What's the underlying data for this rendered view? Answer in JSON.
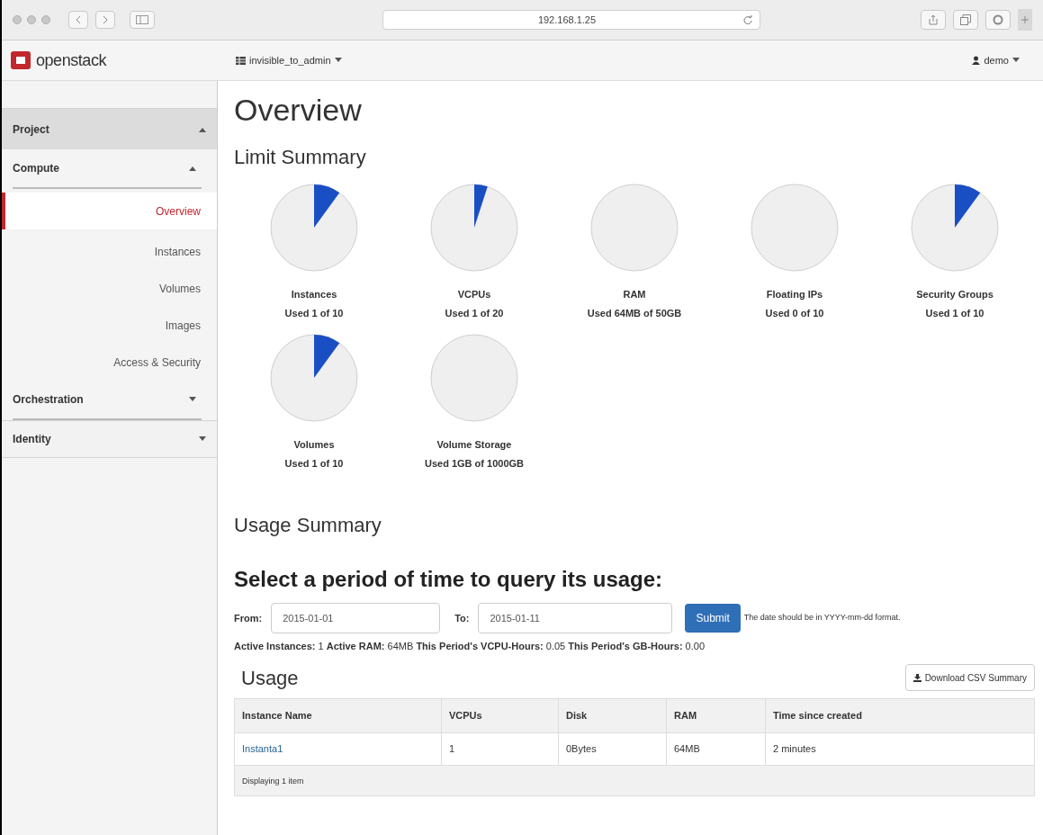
{
  "browser": {
    "url": "192.168.1.25"
  },
  "topbar": {
    "logo": "openstack",
    "project": "invisible_to_admin",
    "user": "demo"
  },
  "sidebar": [
    {
      "label": "Project",
      "expanded": true,
      "children": [
        {
          "label": "Compute",
          "expanded": true,
          "children": [
            {
              "label": "Overview",
              "selected": true
            },
            {
              "label": "Instances",
              "selected": false
            },
            {
              "label": "Volumes",
              "selected": false
            },
            {
              "label": "Images",
              "selected": false
            },
            {
              "label": "Access & Security",
              "selected": false
            }
          ]
        },
        {
          "label": "Orchestration",
          "expanded": false
        }
      ]
    },
    {
      "label": "Identity",
      "expanded": false
    }
  ],
  "page_title": "Overview",
  "limit_summary": {
    "title": "Limit Summary",
    "rows": [
      [
        {
          "name": "Instances",
          "usage": "Used 1 of 10"
        },
        {
          "name": "VCPUs",
          "usage": "Used 1 of 20"
        },
        {
          "name": "RAM",
          "usage": "Used 64MB of 50GB"
        },
        {
          "name": "Floating IPs",
          "usage": "Used 0 of 10"
        },
        {
          "name": "Security Groups",
          "usage": "Used 1 of 10"
        }
      ],
      [
        {
          "name": "Volumes",
          "usage": "Used 1 of 10"
        },
        {
          "name": "Volume Storage",
          "usage": "Used 1GB of 1000GB"
        }
      ]
    ]
  },
  "usage_summary": {
    "title": "Usage Summary",
    "query_title": "Select a period of time to query its usage:",
    "from_label": "From:",
    "from_value": "2015-01-01",
    "to_label": "To:",
    "to_value": "2015-01-11",
    "submit": "Submit",
    "hint": "The date should be in YYYY-mm-dd format.",
    "stats": "**Active Instances:** 1 **Active RAM:** 64MB **This Period's VCPU-Hours:** 0.05 **This Period's GB-Hours:** 0.00"
  },
  "usage": {
    "title": "Usage",
    "download": "Download CSV Summary",
    "columns": [
      "Instance Name",
      "VCPUs",
      "Disk",
      "RAM",
      "Time since created"
    ],
    "rows": [
      [
        "Instanta1",
        "1",
        "0Bytes",
        "64MB",
        "2 minutes"
      ]
    ],
    "footer": "Displaying 1 item"
  }
}
